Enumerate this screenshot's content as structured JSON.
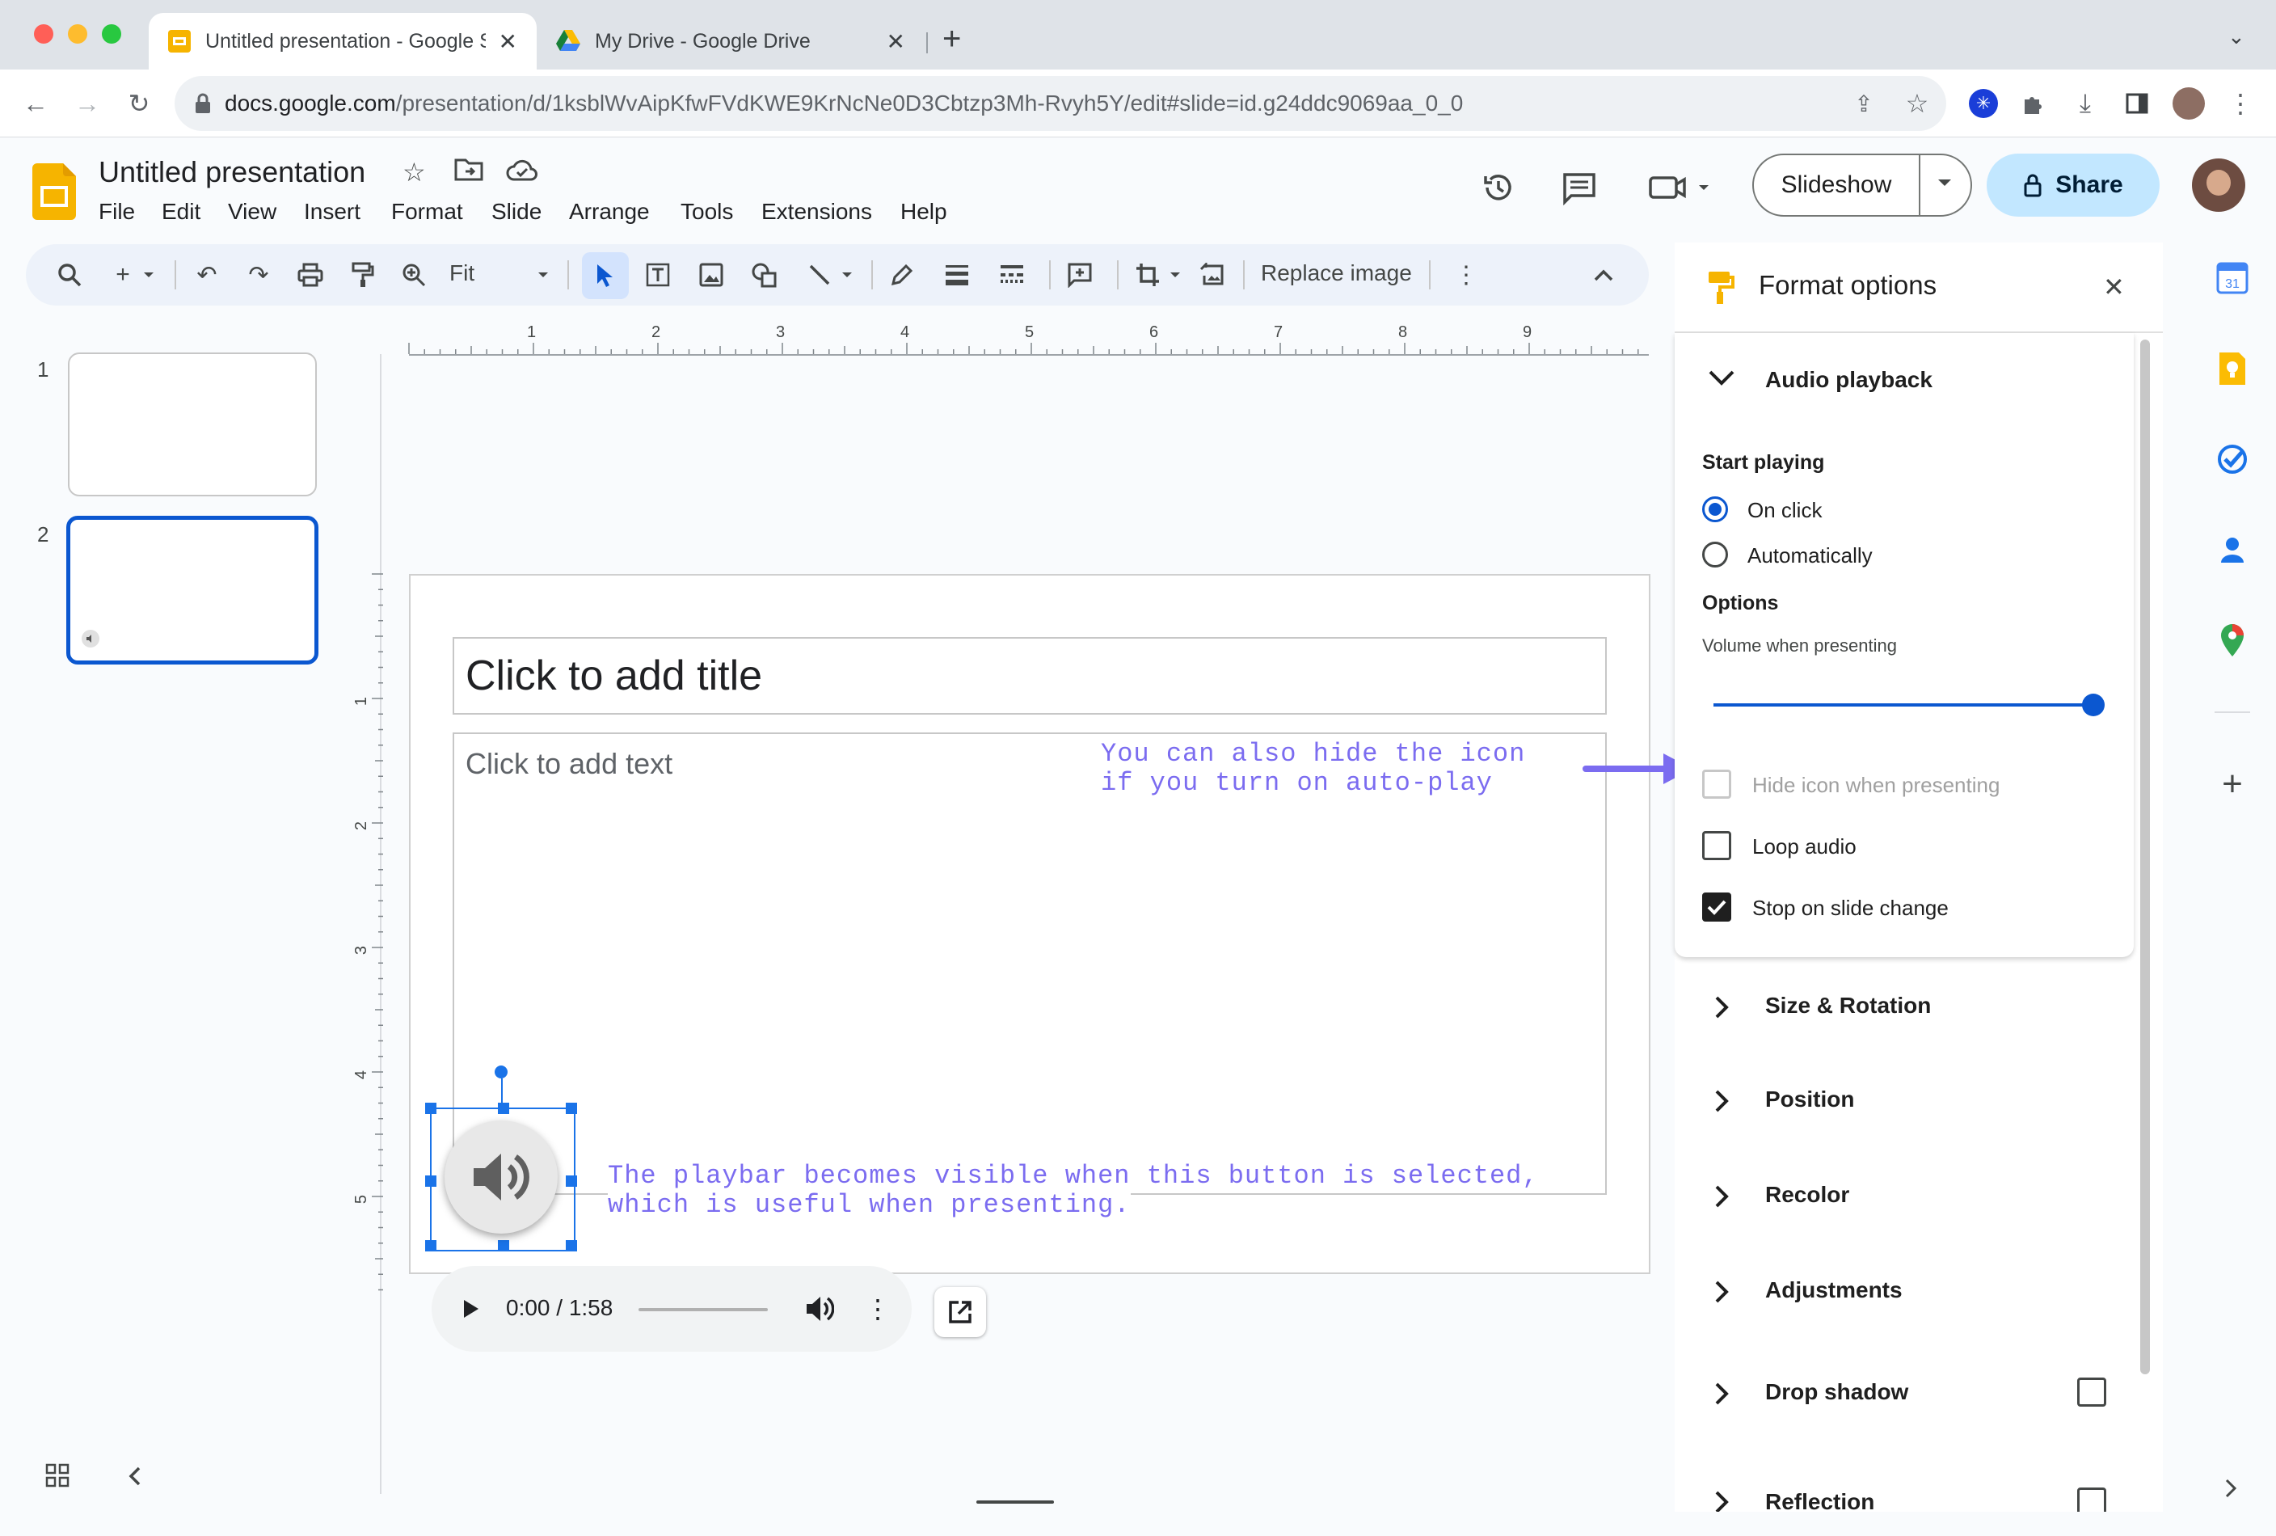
{
  "browser": {
    "tabs": [
      {
        "title": "Untitled presentation - Google Slides",
        "active": true
      },
      {
        "title": "My Drive - Google Drive",
        "active": false
      }
    ],
    "new_tab": "+",
    "url_host": "docs.google.com",
    "url_path": "/presentation/d/1ksblWvAipKfwFVdKWE9KrNcNe0D3Cbtzp3Mh-Rvyh5Y/edit#slide=id.g24ddc9069aa_0_0"
  },
  "doc": {
    "title": "Untitled presentation",
    "menu": [
      "File",
      "Edit",
      "View",
      "Insert",
      "Format",
      "Slide",
      "Arrange",
      "Tools",
      "Extensions",
      "Help"
    ],
    "slideshow_label": "Slideshow",
    "share_label": "Share"
  },
  "toolbar": {
    "zoom_label": "Fit",
    "replace_image_label": "Replace image"
  },
  "filmstrip": {
    "slides": [
      {
        "number": "1"
      },
      {
        "number": "2"
      }
    ]
  },
  "ruler": {
    "top_labels": [
      "1",
      "2",
      "3",
      "4",
      "5",
      "6",
      "7",
      "8",
      "9"
    ],
    "left_labels": [
      "1",
      "2",
      "3",
      "4",
      "5"
    ]
  },
  "slide": {
    "title_placeholder": "Click to add title",
    "body_placeholder": "Click to add text"
  },
  "annotations": {
    "hide_icon_line1": "You can also hide the icon",
    "hide_icon_line2": "if you turn on auto-play",
    "playbar_line1": "The playbar becomes visible when this button is selected,",
    "playbar_line2": "which is useful when presenting."
  },
  "player": {
    "time": "0:00 / 1:58",
    "progress_fraction": 0.0
  },
  "format_panel": {
    "title": "Format options",
    "audio_section": "Audio playback",
    "start_playing": "Start playing",
    "on_click": "On click",
    "automatically": "Automatically",
    "options": "Options",
    "volume_label": "Volume when presenting",
    "volume_fraction": 1.0,
    "hide_icon": "Hide icon when presenting",
    "loop_audio": "Loop audio",
    "stop_on_change": "Stop on slide change",
    "sections": [
      "Size & Rotation",
      "Position",
      "Recolor",
      "Adjustments",
      "Drop shadow",
      "Reflection"
    ]
  },
  "colors": {
    "accent": "#0b57d0",
    "share_bg": "#c2e7ff",
    "annotation": "#7b6cf0",
    "selection": "#1a73e8"
  }
}
